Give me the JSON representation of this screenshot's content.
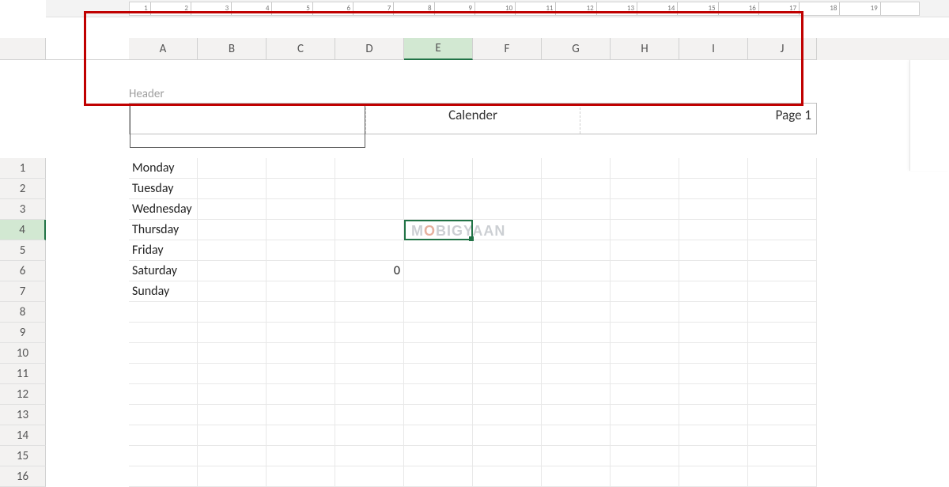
{
  "ruler": {
    "marks": [
      1,
      2,
      3,
      4,
      5,
      6,
      7,
      8,
      9,
      10,
      11,
      12,
      13,
      14,
      15,
      16,
      17,
      18,
      19
    ]
  },
  "columns": [
    "A",
    "B",
    "C",
    "D",
    "E",
    "F",
    "G",
    "H",
    "I",
    "J"
  ],
  "active_column_index": 4,
  "rows": [
    "1",
    "2",
    "3",
    "4",
    "5",
    "6",
    "7",
    "8",
    "9",
    "10",
    "11",
    "12",
    "13",
    "14",
    "15",
    "16"
  ],
  "active_row_index": 3,
  "header": {
    "label": "Header",
    "left": "",
    "center": "Calender",
    "right": "Page 1"
  },
  "cells": {
    "A1": "Monday",
    "A2": "Tuesday",
    "A3": "Wednesday",
    "A4": "Thursday",
    "A5": "Friday",
    "A6": "Saturday",
    "A7": "Sunday",
    "D6": "0"
  },
  "selected_cell": "E4",
  "watermark": "MOBIGYAAN"
}
